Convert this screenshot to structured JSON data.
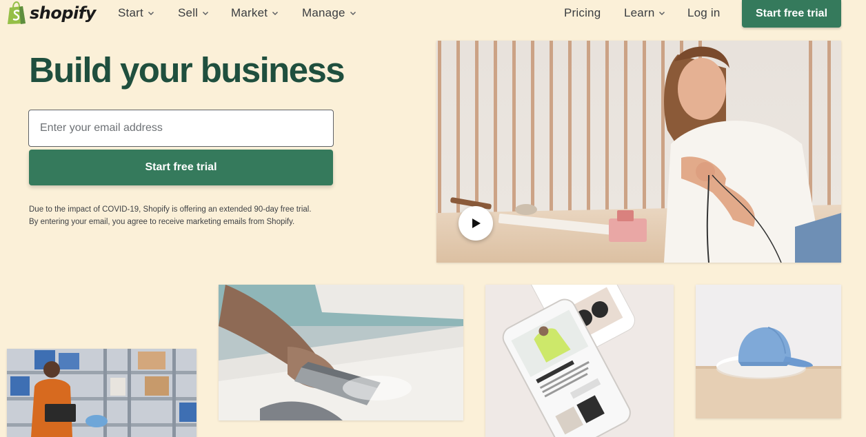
{
  "brand": {
    "name": "shopify",
    "color": "#95bf47"
  },
  "nav": {
    "items": [
      {
        "label": "Start",
        "has_dropdown": true
      },
      {
        "label": "Sell",
        "has_dropdown": true
      },
      {
        "label": "Market",
        "has_dropdown": true
      },
      {
        "label": "Manage",
        "has_dropdown": true
      }
    ],
    "right": {
      "pricing": "Pricing",
      "learn": "Learn",
      "login": "Log in",
      "cta": "Start free trial"
    }
  },
  "hero": {
    "title": "Build your business",
    "email_placeholder": "Enter your email address",
    "email_value": "",
    "cta": "Start free trial",
    "disclaimer": "Due to the impact of COVID-19, Shopify is offering an extended 90-day free trial. By entering your email, you agree to receive marketing emails from Shopify."
  },
  "colors": {
    "background": "#fbf0d8",
    "accent": "#357a5c",
    "title": "#1f4f3e"
  },
  "icons": {
    "play": "play-icon",
    "chevron": "chevron-down-icon",
    "logo": "shopping-bag-icon"
  }
}
